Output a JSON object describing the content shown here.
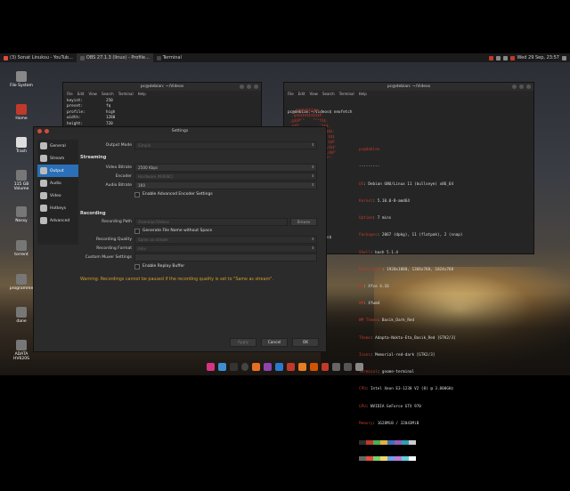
{
  "topbar": {
    "tasks": [
      {
        "label": "(3) Sonat Linuksu - YouTub...",
        "active": false
      },
      {
        "label": "OBS 27.1.3 (linux) - Profile...",
        "active": true
      },
      {
        "label": "Terminal",
        "active": false
      }
    ],
    "clock": "Wed 29 Sep, 23:57"
  },
  "desktop": {
    "icons": [
      "File System",
      "Home",
      "Trash",
      "115 GB Volume",
      "Nossy",
      "torrent",
      "programme",
      "dane",
      "ADATA HV620S"
    ]
  },
  "term1": {
    "title": "pc@debian: ~/Videos",
    "menu": [
      "File",
      "Edit",
      "View",
      "Search",
      "Terminal",
      "Help"
    ],
    "lines": [
      "keyint:          250",
      "preset:          fq",
      "profile:         high",
      "width:           1280",
      "height:          720"
    ]
  },
  "term2": {
    "title": "pc@debian: ~/Videos",
    "menu": [
      "File",
      "Edit",
      "View",
      "Search",
      "Terminal",
      "Help"
    ],
    "prompt": "pc@debian:~/Videos$ neofetch",
    "userhost": "pc@debian",
    "separator": "---------",
    "info": [
      {
        "k": "OS",
        "v": "Debian GNU/Linux 11 (bullseye) x86_64"
      },
      {
        "k": "Kernel",
        "v": "5.10.0-8-amd64"
      },
      {
        "k": "Uptime",
        "v": "7 mins"
      },
      {
        "k": "Packages",
        "v": "2067 (dpkg), 11 (flatpak), 2 (snap)"
      },
      {
        "k": "Shell",
        "v": "bash 5.1.4"
      },
      {
        "k": "Resolution",
        "v": "1920x1080, 1366x768, 1024x768"
      },
      {
        "k": "DE",
        "v": "Xfce 4.16"
      },
      {
        "k": "WM",
        "v": "Xfwm4"
      },
      {
        "k": "WM Theme",
        "v": "Basik_Dark_Red"
      },
      {
        "k": "Theme",
        "v": "Adapta-Nokto-Eta_Basik_Red [GTK2/3]"
      },
      {
        "k": "Icons",
        "v": "Memorial-red-dark [GTK2/3]"
      },
      {
        "k": "Terminal",
        "v": "gnome-terminal"
      },
      {
        "k": "CPU",
        "v": "Intel Xeon E3-1230 V2 (8) @ 3.800GHz"
      },
      {
        "k": "GPU",
        "v": "NVIDIA GeForce GTX 970"
      },
      {
        "k": "Memory",
        "v": "1628MiB / 32043MiB"
      }
    ],
    "prompt2": "pc@debian:~/Videos$",
    "colors": [
      "#2e2e2e",
      "#c0392b",
      "#4caf50",
      "#e0b040",
      "#3d6fb7",
      "#9b59b6",
      "#2aa1b3",
      "#cccccc",
      "#666666",
      "#e74c3c",
      "#7bd16b",
      "#f1d66b",
      "#6fa0e8",
      "#c07ad8",
      "#5fd0e0",
      "#ffffff"
    ]
  },
  "obs": {
    "title": "Settings",
    "sidebar": [
      {
        "label": "General",
        "icon": "gear-icon"
      },
      {
        "label": "Stream",
        "icon": "stream-icon"
      },
      {
        "label": "Output",
        "icon": "output-icon",
        "selected": true
      },
      {
        "label": "Audio",
        "icon": "speaker-icon"
      },
      {
        "label": "Video",
        "icon": "monitor-icon"
      },
      {
        "label": "Hotkeys",
        "icon": "keyboard-icon"
      },
      {
        "label": "Advanced",
        "icon": "tools-icon"
      }
    ],
    "output_mode_label": "Output Mode",
    "output_mode_value": "Simple",
    "streaming_header": "Streaming",
    "video_bitrate_label": "Video Bitrate",
    "video_bitrate_value": "2500 Kbps",
    "encoder_label": "Encoder",
    "encoder_value": "Hardware (NVENC)",
    "audio_bitrate_label": "Audio Bitrate",
    "audio_bitrate_value": "160",
    "adv_encoder_label": "Enable Advanced Encoder Settings",
    "recording_header": "Recording",
    "rec_path_label": "Recording Path",
    "rec_path_value": "/home/pc/Videos",
    "browse_label": "Browse",
    "gen_filename_label": "Generate File Name without Space",
    "rec_quality_label": "Recording Quality",
    "rec_quality_value": "Same as stream",
    "rec_format_label": "Recording Format",
    "rec_format_value": "mkv",
    "custom_muxer_label": "Custom Muxer Settings",
    "replay_label": "Enable Replay Buffer",
    "warning": "Warning: Recordings cannot be paused if the recording quality is set to \"Same as stream\".",
    "apply_label": "Apply",
    "cancel_label": "Cancel",
    "ok_label": "OK"
  }
}
